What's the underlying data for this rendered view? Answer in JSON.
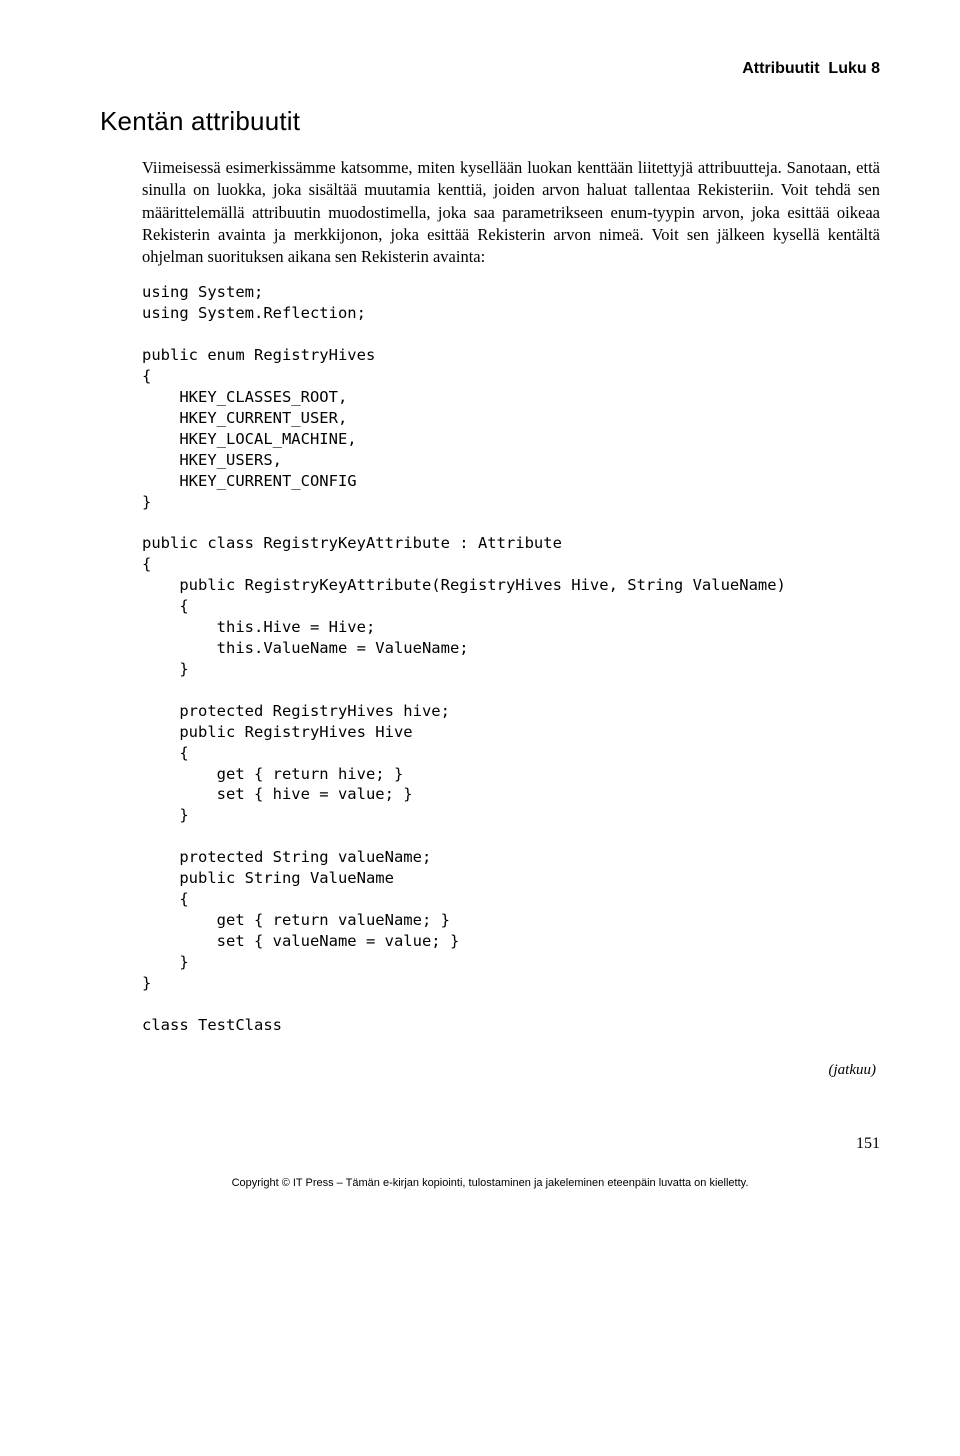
{
  "header": {
    "running": "Attribuutit  Luku 8"
  },
  "section": {
    "title": "Kentän attribuutit",
    "paragraph": "Viimeisessä esimerkissämme katsomme, miten kysellään luokan kenttään liitettyjä attribuutteja. Sanotaan, että sinulla on luokka, joka sisältää muutamia kenttiä, joiden arvon haluat tallentaa Rekisteriin. Voit tehdä sen määrittelemällä attribuutin muodostimella, joka saa parametrikseen enum-tyypin arvon, joka esittää oikeaa Rekisterin avainta ja merkkijonon, joka esittää Rekisterin arvon nimeä. Voit sen jälkeen kysellä kentältä ohjelman suorituksen aikana sen Rekisterin avainta:"
  },
  "code": {
    "lines": "using System;\nusing System.Reflection;\n\npublic enum RegistryHives\n{\n    HKEY_CLASSES_ROOT,\n    HKEY_CURRENT_USER,\n    HKEY_LOCAL_MACHINE,\n    HKEY_USERS,\n    HKEY_CURRENT_CONFIG\n}\n\npublic class RegistryKeyAttribute : Attribute\n{\n    public RegistryKeyAttribute(RegistryHives Hive, String ValueName)\n    {\n        this.Hive = Hive;\n        this.ValueName = ValueName;\n    }\n\n    protected RegistryHives hive;\n    public RegistryHives Hive\n    {\n        get { return hive; }\n        set { hive = value; }\n    }\n\n    protected String valueName;\n    public String ValueName\n    {\n        get { return valueName; }\n        set { valueName = value; }\n    }\n}\n\nclass TestClass"
  },
  "continuation": "(jatkuu)",
  "page_number": "151",
  "footer": "Copyright © IT Press – Tämän e-kirjan kopiointi, tulostaminen ja jakeleminen eteenpäin luvatta on kielletty."
}
